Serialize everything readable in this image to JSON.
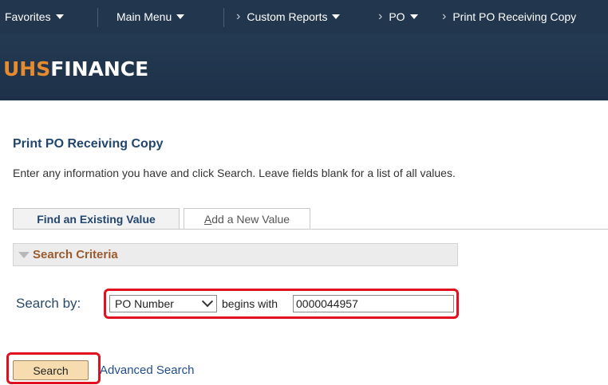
{
  "nav": {
    "favorites": "Favorites",
    "main_menu": "Main Menu",
    "breadcrumb": [
      "Custom Reports",
      "PO",
      "Print PO Receiving Copy"
    ]
  },
  "brand": {
    "prefix": "UHS",
    "suffix": "FINANCE"
  },
  "page": {
    "title": "Print PO Receiving Copy",
    "instructions": "Enter any information you have and click Search. Leave fields blank for a list of all values."
  },
  "tabs": [
    {
      "label": "Find an Existing Value",
      "active": true
    },
    {
      "label_underlined": "A",
      "label_rest": "dd a New Value",
      "active": false
    }
  ],
  "search_criteria": {
    "header": "Search Criteria",
    "search_by_label": "Search by:",
    "field_select": "PO Number",
    "operator": "begins with",
    "value": "0000044957"
  },
  "buttons": {
    "search": "Search",
    "advanced_search": "Advanced Search"
  },
  "colors": {
    "nav_bg": "#22364d",
    "brand_orange": "#e88b2e",
    "highlight_red": "#e0101f"
  }
}
